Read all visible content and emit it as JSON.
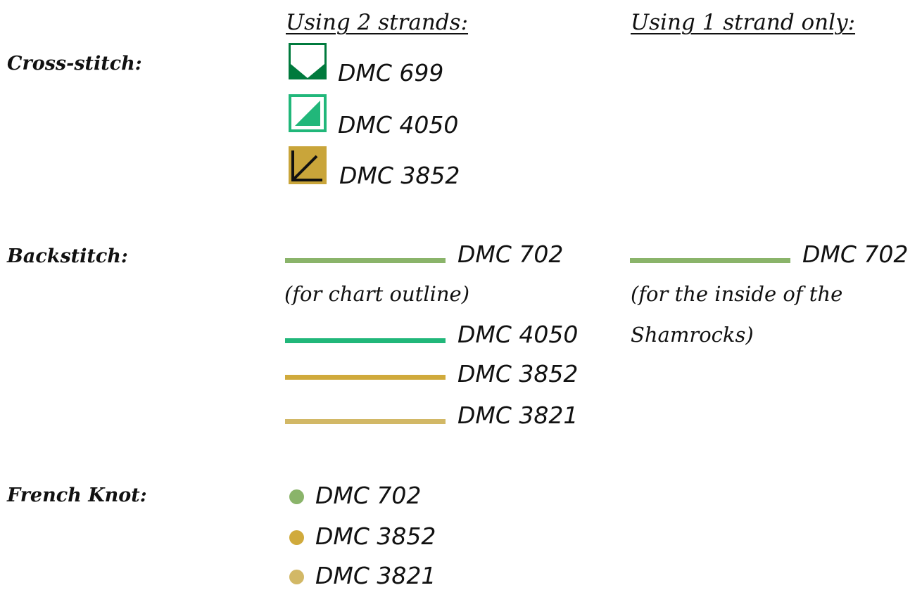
{
  "headers": {
    "two_strands": "Using 2 strands:",
    "one_strand": "Using 1 strand only:"
  },
  "sections": {
    "cross_stitch": "Cross-stitch:",
    "backstitch": "Backstitch:",
    "french_knot": "French Knot:"
  },
  "cross_stitch": [
    {
      "label": "DMC 699",
      "color": "#007a3d",
      "symbol": "white-shield-on-dark-green"
    },
    {
      "label": "DMC 4050",
      "color": "#21b77a",
      "symbol": "green-triangle-on-white"
    },
    {
      "label": "DMC 3852",
      "color": "#c9a53a",
      "symbol": "black-diagonal-arrow"
    }
  ],
  "backstitch_two": [
    {
      "label": "DMC 702",
      "color": "#8ab46a"
    },
    {
      "label": "DMC 4050",
      "color": "#21b77a"
    },
    {
      "label": "DMC 3852",
      "color": "#d0aa3c"
    },
    {
      "label": "DMC 3821",
      "color": "#d2b866"
    }
  ],
  "backstitch_two_note": "(for chart outline)",
  "backstitch_one": {
    "label": "DMC 702",
    "color": "#8ab46a",
    "note_line1": "(for the inside of the",
    "note_line2": "Shamrocks)"
  },
  "french_knot": [
    {
      "label": "DMC 702",
      "color": "#8ab46a"
    },
    {
      "label": "DMC 3852",
      "color": "#d0aa3c"
    },
    {
      "label": "DMC 3821",
      "color": "#d2b866"
    }
  ]
}
